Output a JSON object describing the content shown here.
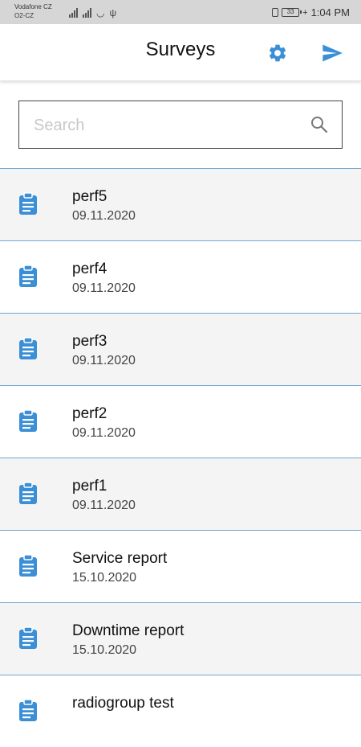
{
  "status_bar": {
    "carrier_line1": "Vodafone CZ",
    "carrier_line2": "O2-CZ",
    "battery": "33",
    "time": "1:04 PM"
  },
  "header": {
    "title": "Surveys",
    "settings_icon": "gear-icon",
    "send_icon": "send-icon",
    "accent_color": "#3a8fd6"
  },
  "search": {
    "placeholder": "Search",
    "value": ""
  },
  "surveys": [
    {
      "name": "perf5",
      "date": "09.11.2020"
    },
    {
      "name": "perf4",
      "date": "09.11.2020"
    },
    {
      "name": "perf3",
      "date": "09.11.2020"
    },
    {
      "name": "perf2",
      "date": "09.11.2020"
    },
    {
      "name": "perf1",
      "date": "09.11.2020"
    },
    {
      "name": "Service report",
      "date": "15.10.2020"
    },
    {
      "name": "Downtime report",
      "date": "15.10.2020"
    },
    {
      "name": "radiogroup test",
      "date": ""
    }
  ],
  "colors": {
    "divider": "#6fa8d6",
    "row_shade": "#f4f4f4",
    "status_bar": "#d6d6d6"
  }
}
